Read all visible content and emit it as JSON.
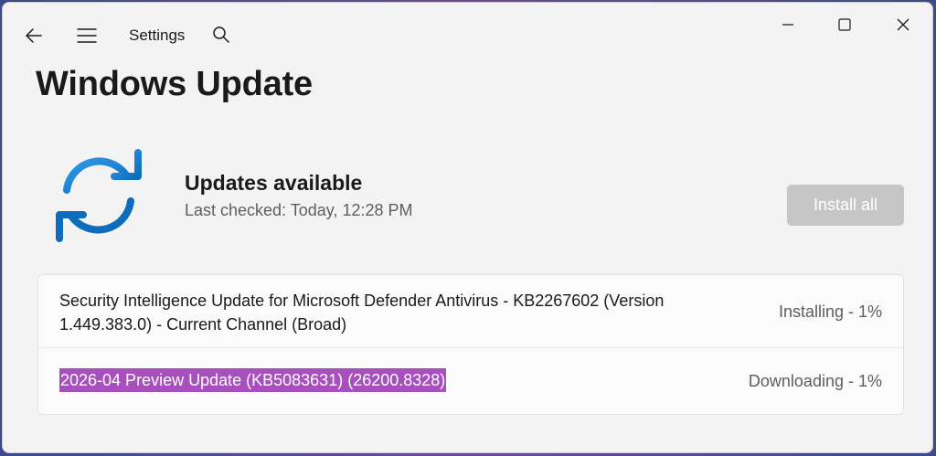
{
  "window": {
    "app_title": "Settings",
    "icons": {
      "back": "back-arrow-icon",
      "menu": "hamburger-menu-icon",
      "search": "search-icon",
      "minimize": "minimize-icon",
      "maximize": "maximize-icon",
      "close": "close-icon"
    }
  },
  "page": {
    "title": "Windows Update"
  },
  "status": {
    "heading": "Updates available",
    "last_checked": "Last checked: Today, 12:28 PM",
    "icon": "sync-arrows-icon",
    "install_button_label": "Install all",
    "install_button_enabled": false
  },
  "updates": [
    {
      "name": "Security Intelligence Update for Microsoft Defender Antivirus - KB2267602 (Version 1.449.383.0) - Current Channel (Broad)",
      "status": "Installing - 1%"
    },
    {
      "name": "2026-04 Preview Update (KB5083631) (26200.8328)",
      "status": "Downloading - 1%",
      "selected_text": true
    }
  ],
  "colors": {
    "accent_blue": "#0f6cbd",
    "text_selection": "#a74fbd",
    "disabled_button": "#c6c6c6"
  }
}
